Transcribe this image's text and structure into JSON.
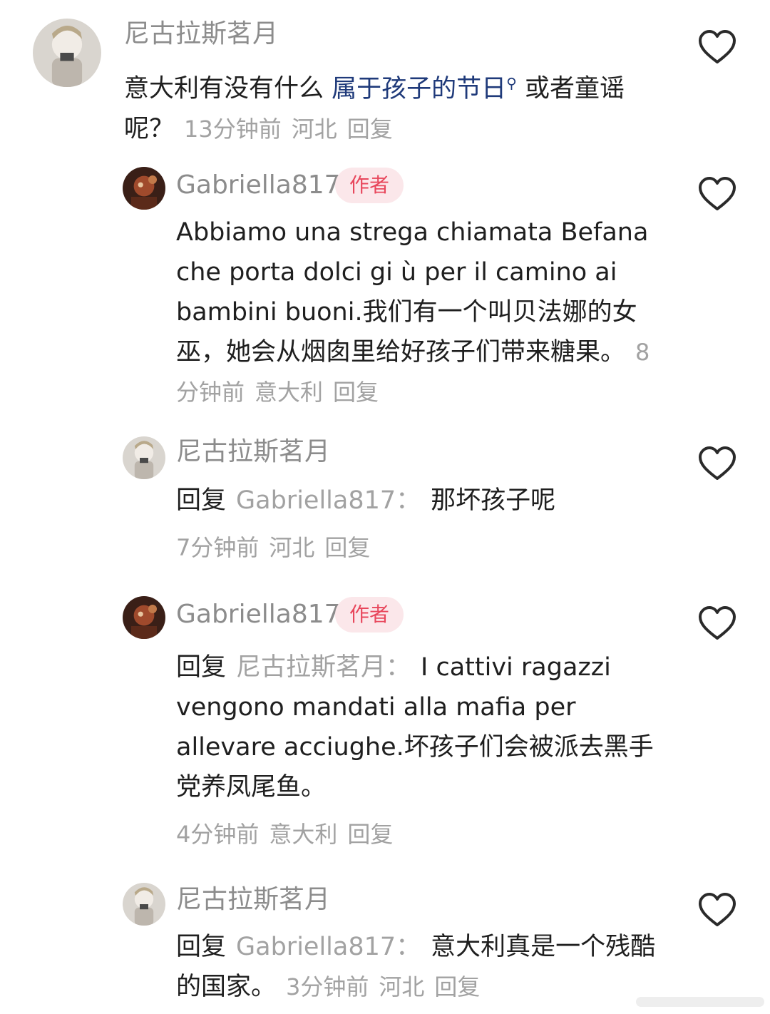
{
  "comments": [
    {
      "user": "尼古拉斯茗月",
      "text_before": "意大利有没有什么 ",
      "search_link": "属于孩子的节日",
      "text_after": " 或者童谣呢？",
      "time": "13分钟前",
      "location": "河北",
      "reply": "回复"
    },
    {
      "user": "Gabriella817",
      "badge": "作者",
      "text": "Abbiamo una strega chiamata Befana che porta dolci gi ù  per il camino ai bambini buoni.我们有一个叫贝法娜的女巫，她会从烟囱里给好孩子们带来糖果。",
      "time": "8分钟前",
      "location": "意大利",
      "reply": "回复"
    },
    {
      "user": "尼古拉斯茗月",
      "reply_prefix": "回复",
      "reply_to": "Gabriella817：",
      "text": "那坏孩子呢",
      "time": "7分钟前",
      "location": "河北",
      "reply": "回复"
    },
    {
      "user": "Gabriella817",
      "badge": "作者",
      "reply_prefix": "回复",
      "reply_to": "尼古拉斯茗月：",
      "text": "I cattivi ragazzi vengono mandati alla mafia per allevare acciughe.坏孩子们会被派去黑手党养凤尾鱼。",
      "time": "4分钟前",
      "location": "意大利",
      "reply": "回复"
    },
    {
      "user": "尼古拉斯茗月",
      "reply_prefix": "回复",
      "reply_to": "Gabriella817：",
      "text": "意大利真是一个残酷的国家。",
      "time": "3分钟前",
      "location": "河北",
      "reply": "回复"
    }
  ],
  "icons": {
    "like": "heart-outline-icon",
    "search": "search-icon"
  },
  "colors": {
    "badge_bg": "#fbe7ea",
    "badge_text": "#e8475c",
    "link": "#1f3a7a",
    "meta": "#a2a2a2"
  }
}
